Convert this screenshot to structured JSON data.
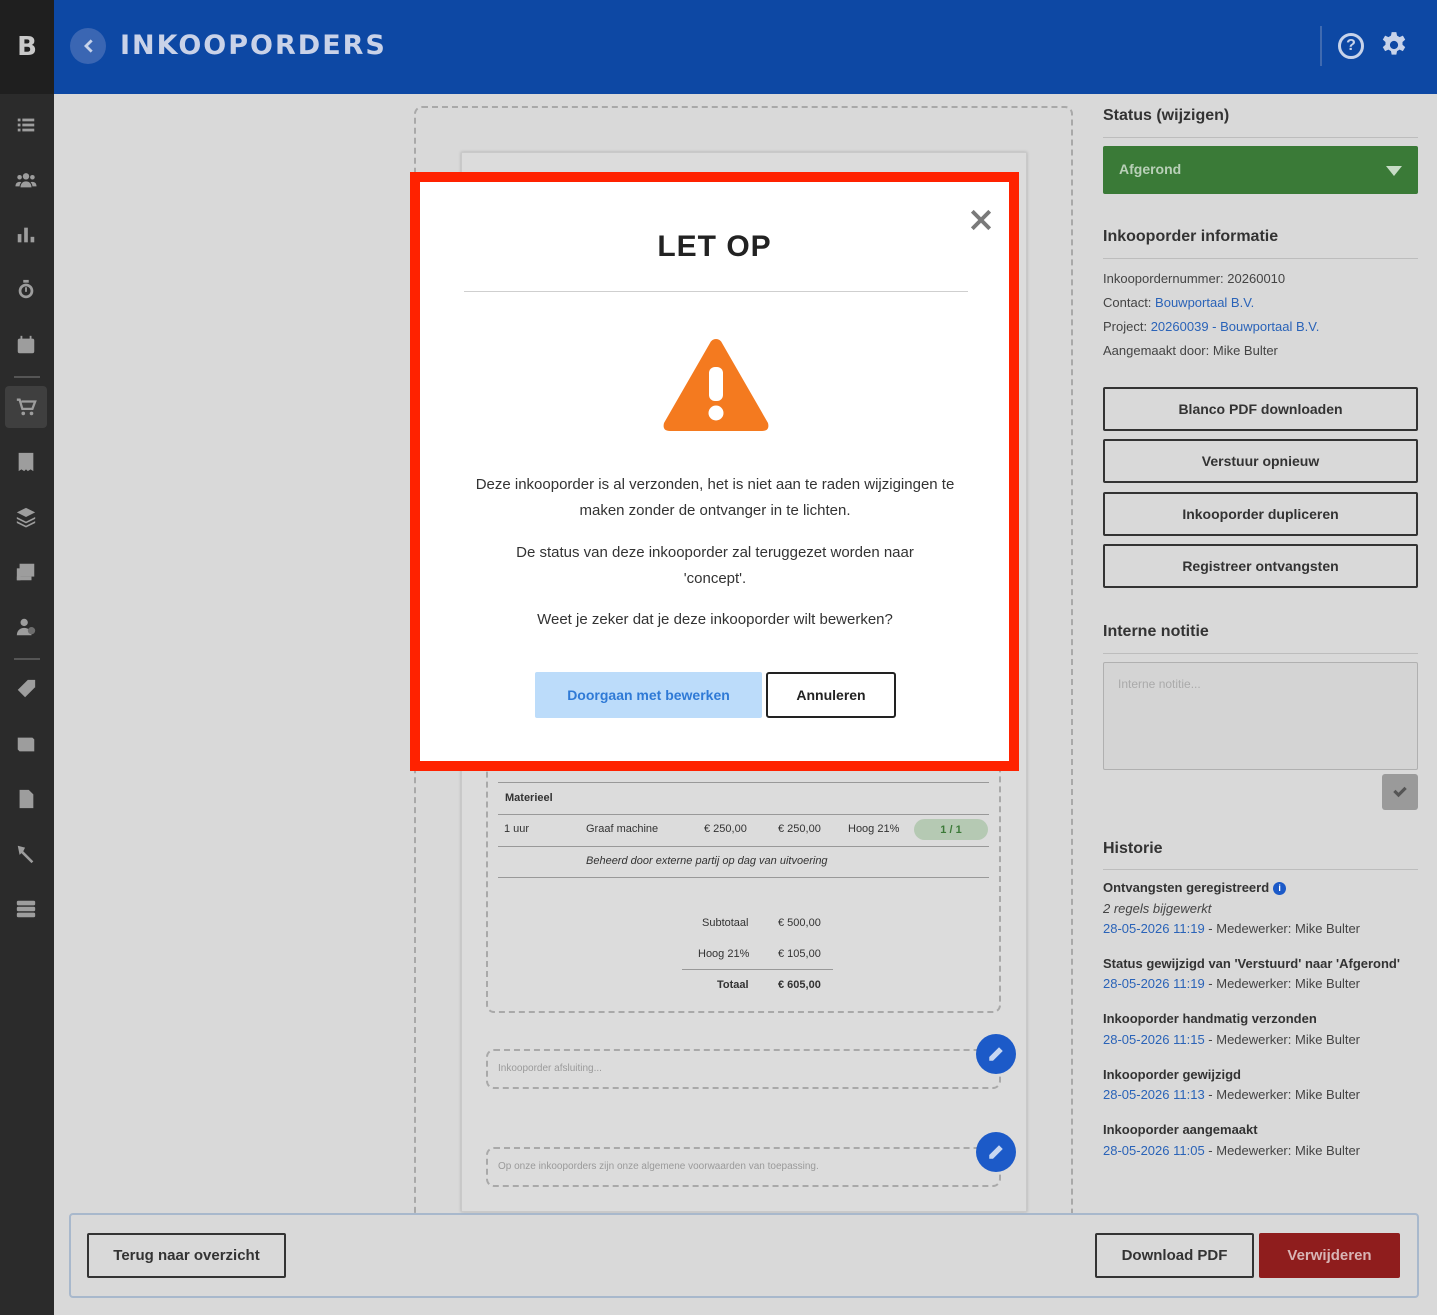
{
  "app": {
    "logo_letter": "B",
    "title": "INKOOPORDERS"
  },
  "sidebar": {
    "items": [
      {
        "name": "list-icon"
      },
      {
        "name": "users-icon"
      },
      {
        "name": "chart-icon"
      },
      {
        "name": "stopwatch-icon"
      },
      {
        "name": "calendar-icon"
      },
      {
        "name": "cart-icon",
        "active": true
      },
      {
        "name": "receipt-icon"
      },
      {
        "name": "layers-icon"
      },
      {
        "name": "invoice-icon"
      },
      {
        "name": "user-settings-icon"
      },
      {
        "name": "tag-icon"
      },
      {
        "name": "book-icon"
      },
      {
        "name": "file-plus-icon"
      },
      {
        "name": "tools-icon"
      },
      {
        "name": "server-icon"
      }
    ]
  },
  "document": {
    "section_header": "Materieel",
    "line": {
      "qty": "1 uur",
      "description": "Graaf machine",
      "price": "€ 250,00",
      "total": "€ 250,00",
      "vat": "Hoog 21%",
      "received": "1 / 1",
      "note": "Beheerd door externe partij op dag van uitvoering"
    },
    "totals": {
      "subtotal_label": "Subtotaal",
      "subtotal_value": "€ 500,00",
      "vat_label": "Hoog 21%",
      "vat_value": "€ 105,00",
      "total_label": "Totaal",
      "total_value": "€ 605,00"
    },
    "closing_placeholder": "Inkooporder afsluiting...",
    "terms_text": "Op onze inkooporders zijn onze algemene voorwaarden van toepassing."
  },
  "right_panel": {
    "status_heading": "Status (wijzigen)",
    "status_value": "Afgerond",
    "info_heading": "Inkooporder informatie",
    "order_number_label": "Inkoopordernummer:",
    "order_number": "20260010",
    "contact_label": "Contact:",
    "contact": "Bouwportaal B.V.",
    "project_label": "Project:",
    "project": "20260039 - Bouwportaal B.V.",
    "created_by_label": "Aangemaakt door:",
    "created_by": "Mike Bulter",
    "buttons": {
      "blank_pdf": "Blanco PDF downloaden",
      "resend": "Verstuur opnieuw",
      "duplicate": "Inkooporder dupliceren",
      "register": "Registreer ontvangsten"
    },
    "note_heading": "Interne notitie",
    "note_placeholder": "Interne notitie...",
    "history_heading": "Historie",
    "history": [
      {
        "title": "Ontvangsten geregistreerd",
        "sub": "2 regels bijgewerkt",
        "date": "28-05-2026 11:19",
        "meta": " - Medewerker: Mike Bulter"
      },
      {
        "title": "Status gewijzigd van 'Verstuurd' naar 'Afgerond'",
        "date": "28-05-2026 11:19",
        "meta": " - Medewerker: Mike Bulter"
      },
      {
        "title": "Inkooporder handmatig verzonden",
        "date": "28-05-2026 11:15",
        "meta": " - Medewerker: Mike Bulter"
      },
      {
        "title": "Inkooporder gewijzigd",
        "date": "28-05-2026 11:13",
        "meta": " - Medewerker: Mike Bulter"
      },
      {
        "title": "Inkooporder aangemaakt",
        "date": "28-05-2026 11:05",
        "meta": " - Medewerker: Mike Bulter"
      }
    ]
  },
  "footer": {
    "back_label": "Terug naar overzicht",
    "pdf_label": "Download PDF",
    "delete_label": "Verwijderen"
  },
  "modal": {
    "title": "LET OP",
    "paragraph1": "Deze inkooporder is al verzonden, het is niet aan te raden wijzigingen te maken zonder de ontvanger in te lichten.",
    "paragraph2": "De status van deze inkooporder zal teruggezet worden naar 'concept'.",
    "paragraph3": "Weet je zeker dat je deze inkooporder wilt bewerken?",
    "continue_label": "Doorgaan met bewerken",
    "cancel_label": "Annuleren",
    "warning_color": "#f47a1f",
    "highlight_color": "#ff2200"
  }
}
